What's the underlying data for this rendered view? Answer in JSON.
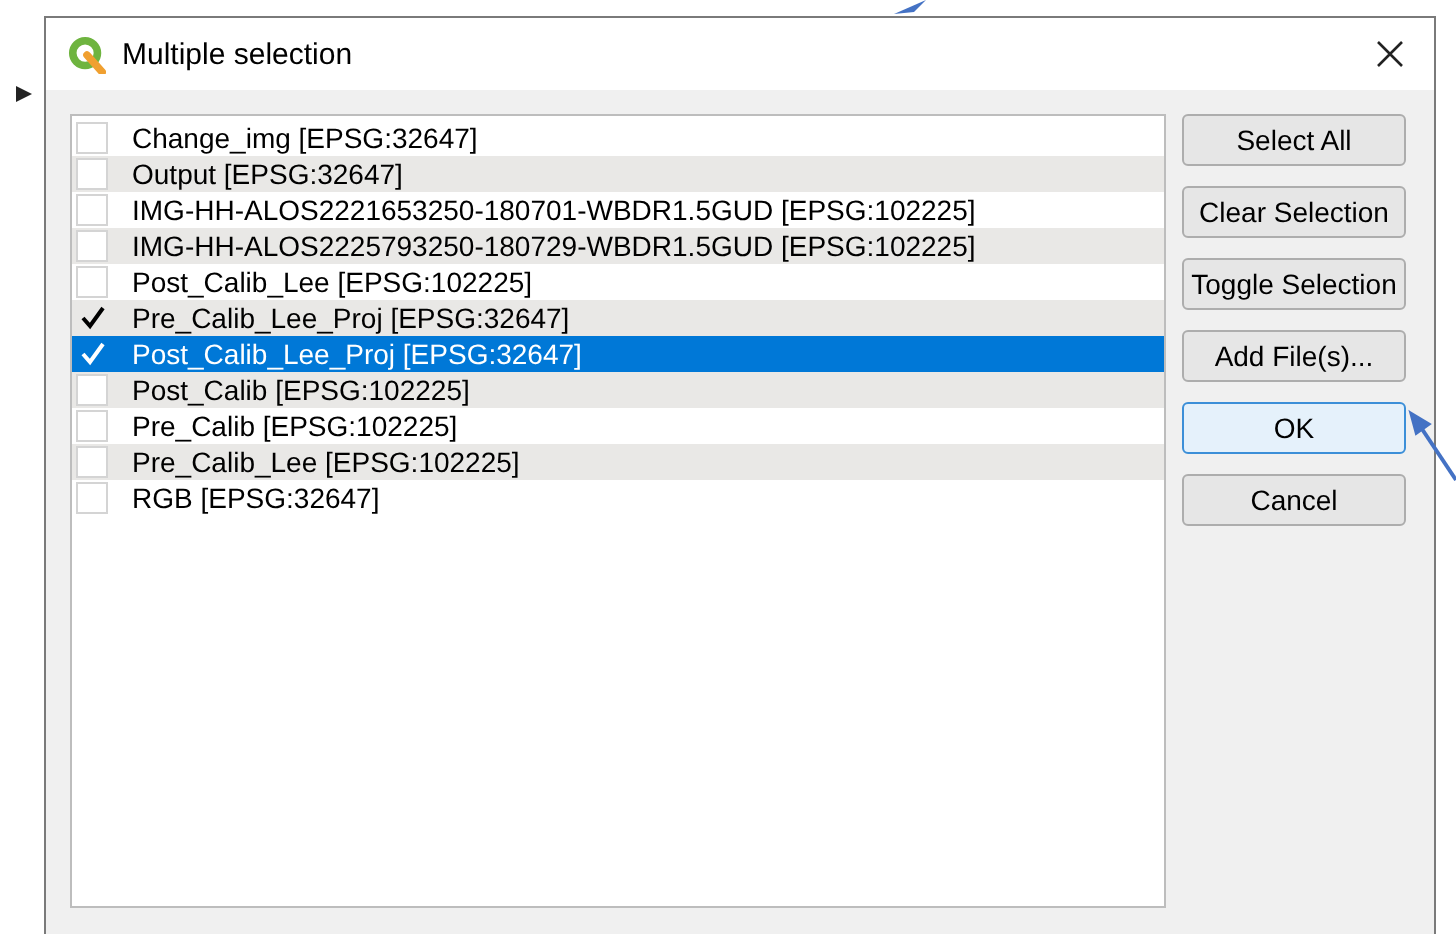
{
  "window": {
    "title": "Multiple selection"
  },
  "layers": [
    {
      "label": "Change_img [EPSG:32647]",
      "checked": false,
      "selected": false
    },
    {
      "label": "Output [EPSG:32647]",
      "checked": false,
      "selected": false
    },
    {
      "label": "IMG-HH-ALOS2221653250-180701-WBDR1.5GUD [EPSG:102225]",
      "checked": false,
      "selected": false
    },
    {
      "label": "IMG-HH-ALOS2225793250-180729-WBDR1.5GUD [EPSG:102225]",
      "checked": false,
      "selected": false
    },
    {
      "label": "Post_Calib_Lee [EPSG:102225]",
      "checked": false,
      "selected": false
    },
    {
      "label": "Pre_Calib_Lee_Proj [EPSG:32647]",
      "checked": true,
      "selected": false
    },
    {
      "label": "Post_Calib_Lee_Proj [EPSG:32647]",
      "checked": true,
      "selected": true
    },
    {
      "label": "Post_Calib [EPSG:102225]",
      "checked": false,
      "selected": false
    },
    {
      "label": "Pre_Calib [EPSG:102225]",
      "checked": false,
      "selected": false
    },
    {
      "label": "Pre_Calib_Lee [EPSG:102225]",
      "checked": false,
      "selected": false
    },
    {
      "label": "RGB [EPSG:32647]",
      "checked": false,
      "selected": false
    }
  ],
  "buttons": [
    {
      "label": "Select All",
      "focused": false
    },
    {
      "label": "Clear Selection",
      "focused": false
    },
    {
      "label": "Toggle Selection",
      "focused": false
    },
    {
      "label": "Add File(s)...",
      "focused": false
    },
    {
      "label": "OK",
      "focused": true
    },
    {
      "label": "Cancel",
      "focused": false
    }
  ]
}
